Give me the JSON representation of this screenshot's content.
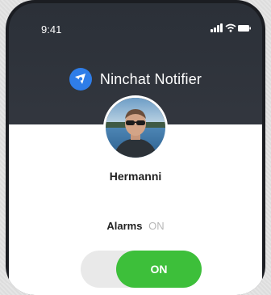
{
  "status_bar": {
    "time": "9:41",
    "icons": [
      "signal-icon",
      "wifi-icon",
      "battery-icon"
    ]
  },
  "app": {
    "title": "Ninchat Notifier",
    "logo_icon": "ninchat-logo-icon",
    "brand_color": "#2f7de8"
  },
  "profile": {
    "name": "Hermanni",
    "avatar_icon": "avatar"
  },
  "alarms": {
    "label": "Alarms",
    "status": "ON",
    "toggle_label": "ON",
    "toggle_on": true,
    "toggle_color": "#3dbf3a"
  }
}
